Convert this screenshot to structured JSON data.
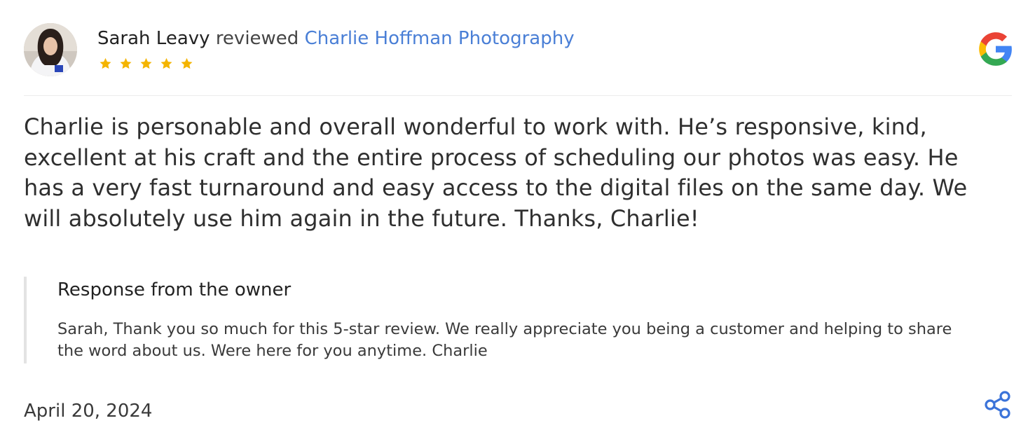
{
  "review": {
    "reviewer_name": "Sarah Leavy",
    "reviewed_word": "reviewed",
    "business_name": "Charlie Hoffman Photography",
    "rating": 5,
    "rating_max": 5,
    "text": "Charlie is personable and overall wonderful to work with. He’s responsive, kind, excellent at his craft and the entire process of scheduling our photos was easy. He has a very fast turnaround and easy access to the digital files on the same day. We will absolutely use him again in the future. Thanks, Charlie!",
    "date": "April 20, 2024"
  },
  "owner_response": {
    "title": "Response from the owner",
    "text": "Sarah, Thank you so much for this 5-star review. We really appreciate you being a customer and helping to share the word about us. Were here for you anytime. Charlie"
  },
  "icons": {
    "source": "google-logo-icon",
    "share": "share-icon",
    "star": "star-icon"
  },
  "colors": {
    "link": "#4a7fd6",
    "star": "#f4b400",
    "share": "#3b73d9",
    "google_blue": "#4285F4",
    "google_red": "#EA4335",
    "google_yellow": "#FBBC05",
    "google_green": "#34A853"
  }
}
